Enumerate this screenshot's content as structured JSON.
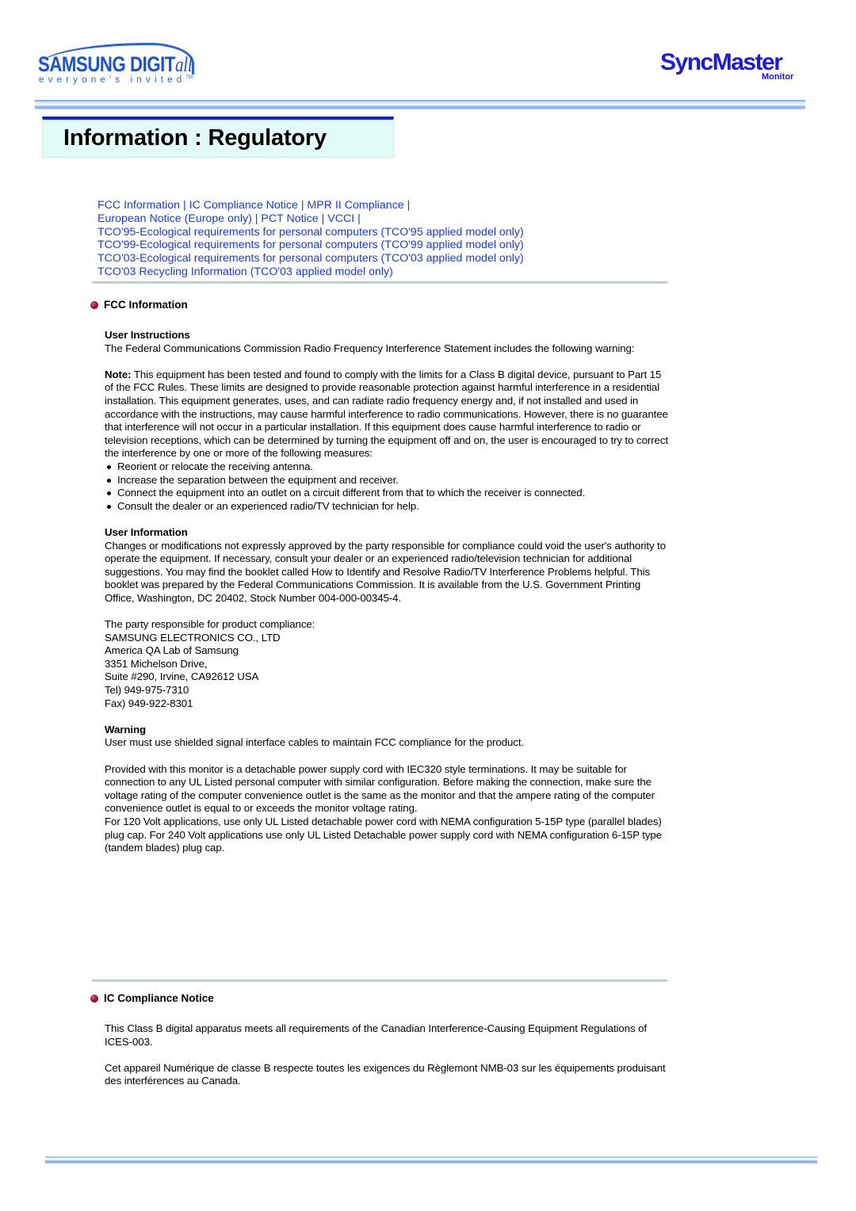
{
  "header": {
    "samsung_logo": {
      "brand": "SAMSUNG DIGIT",
      "brand_suffix": "all",
      "tagline": "everyone's invited",
      "tm": "TM"
    },
    "product_logo": {
      "name": "SyncMaster",
      "sub": "Monitor"
    }
  },
  "page_title": "Information :  Regulatory",
  "nav": {
    "line1": [
      "FCC Information",
      "IC Compliance Notice",
      "MPR II Compliance"
    ],
    "line2": [
      "European Notice (Europe only)",
      "PCT Notice",
      "VCCI"
    ],
    "links3": [
      "TCO'95-Ecological requirements for personal computers (TCO'95 applied model only)",
      "TCO'99-Ecological requirements for personal computers (TCO'99 applied model only)",
      "TCO'03-Ecological requirements for personal computers (TCO'03 applied model only)",
      "TCO'03 Recycling Information (TCO'03 applied model only)"
    ],
    "separator": "|"
  },
  "fcc": {
    "heading": "FCC Information",
    "user_instructions": {
      "heading": "User Instructions",
      "intro": "The Federal Communications Commission Radio Frequency Interference Statement includes the following warning:",
      "note_label": "Note:",
      "note_text": " This equipment has been tested and found to comply with the limits for a Class B digital device, pursuant to Part 15 of the FCC Rules. These limits are designed to provide reasonable protection against harmful interference in a residential installation. This equipment generates, uses, and can radiate radio frequency energy and, if not installed and used in accordance with the instructions, may cause harmful interference to radio communications. However, there is no guarantee that interference will not occur in a particular installation. If this equipment does cause harmful interference to radio or television receptions, which can be determined by turning the equipment off and on, the user is encouraged to try to correct the interference by one or more of the following measures:",
      "measures": [
        "Reorient or relocate the receiving antenna.",
        "Increase the separation between the equipment and receiver.",
        "Connect the equipment into an outlet on a circuit different from that to which the receiver is connected.",
        "Consult the dealer or an experienced radio/TV technician for help."
      ]
    },
    "user_information": {
      "heading": "User Information",
      "text": "Changes or modifications not expressly approved by the party responsible for compliance could void the user's authority to operate the equipment. If necessary, consult your dealer or an experienced radio/television technician for additional suggestions. You may find the booklet called How to Identify and Resolve Radio/TV Interference Problems helpful. This booklet was prepared by the Federal Communications Commission. It is available from the U.S. Government Printing Office, Washington, DC 20402, Stock Number 004-000-00345-4."
    },
    "responsible_party": {
      "intro": "The party responsible for product compliance:",
      "lines": [
        "SAMSUNG ELECTRONICS CO., LTD",
        "America QA Lab of Samsung",
        "3351 Michelson Drive,",
        "Suite #290, Irvine, CA92612 USA",
        "Tel) 949-975-7310",
        "Fax) 949-922-8301"
      ]
    },
    "warning": {
      "heading": "Warning",
      "text": "User must use shielded signal interface cables to maintain FCC compliance for the product.",
      "power_cord": "Provided with this monitor is a detachable power supply cord with IEC320 style terminations. It may be suitable for connection to any UL Listed personal computer with similar configuration. Before making the connection, make sure the voltage rating of the computer convenience outlet is the same as the monitor and that the ampere rating of the computer convenience outlet is equal to or exceeds the monitor voltage rating.",
      "voltage": "For 120 Volt applications, use only UL Listed detachable power cord with NEMA configuration 5-15P type (parallel blades) plug cap. For 240 Volt applications use only UL Listed Detachable power supply cord with NEMA configuration 6-15P type (tandem blades) plug cap."
    }
  },
  "ic": {
    "heading": "IC Compliance Notice",
    "english": "This Class B digital apparatus meets all requirements of the Canadian Interference-Causing Equipment Regulations of ICES-003.",
    "french": "Cet appareil Numérique de classe B respecte toutes les exigences du Règlemont NMB-03 sur les équipements produisant des interférences au Canada."
  },
  "colors": {
    "link": "#1a3cd6",
    "title_bar": "#0c22e6",
    "title_bg": "#e2fbf6",
    "bullet": "#a0103a"
  }
}
